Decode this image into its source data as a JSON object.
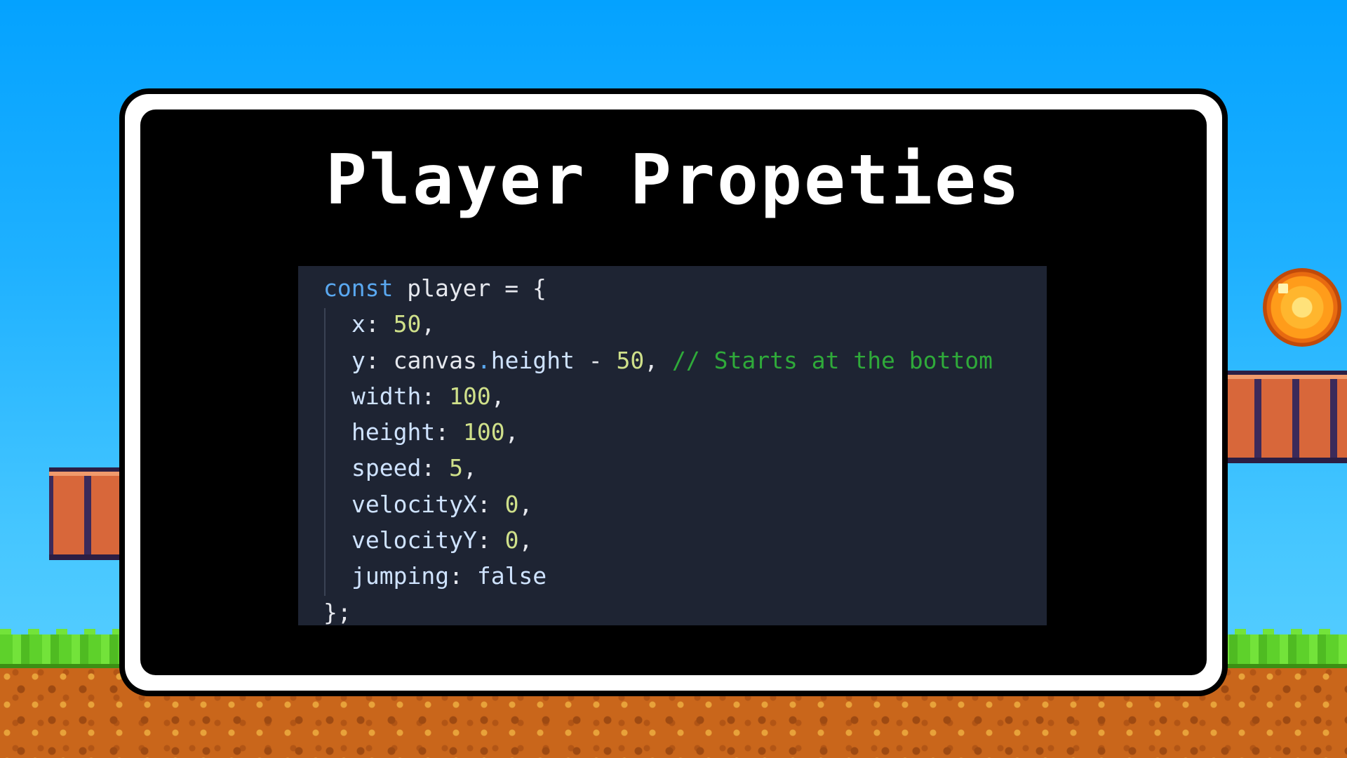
{
  "slide": {
    "title": "Player Propeties"
  },
  "code": {
    "lines": [
      {
        "kw": "const",
        "name": " player",
        "rest": " = {"
      },
      {
        "key": "x",
        "sep": ": ",
        "val": "50",
        "end": ","
      },
      {
        "key": "y",
        "sep": ": ",
        "obj": "canvas",
        "dot": ".",
        "member": "height",
        "op": " - ",
        "val": "50",
        "end": ", ",
        "comment": "// Starts at the bottom"
      },
      {
        "key": "width",
        "sep": ": ",
        "val": "100",
        "end": ","
      },
      {
        "key": "height",
        "sep": ": ",
        "val": "100",
        "end": ","
      },
      {
        "key": "speed",
        "sep": ": ",
        "val": "5",
        "end": ","
      },
      {
        "key": "velocityX",
        "sep": ": ",
        "val": "0",
        "end": ","
      },
      {
        "key": "velocityY",
        "sep": ": ",
        "val": "0",
        "end": ","
      },
      {
        "key": "jumping",
        "sep": ": ",
        "val": "false",
        "end": ""
      },
      {
        "close": "};"
      }
    ]
  },
  "colors": {
    "sky": "#04a2ff",
    "panel_border": "#ffffff",
    "panel_bg": "#000000",
    "code_bg": "#1e2433",
    "keyword": "#5aa8f0",
    "number": "#cfe08a",
    "comment": "#2faa3a"
  },
  "decor": {
    "coin": "coin-icon",
    "bricks": "brick-platform",
    "ground": "grass-dirt-ground"
  }
}
